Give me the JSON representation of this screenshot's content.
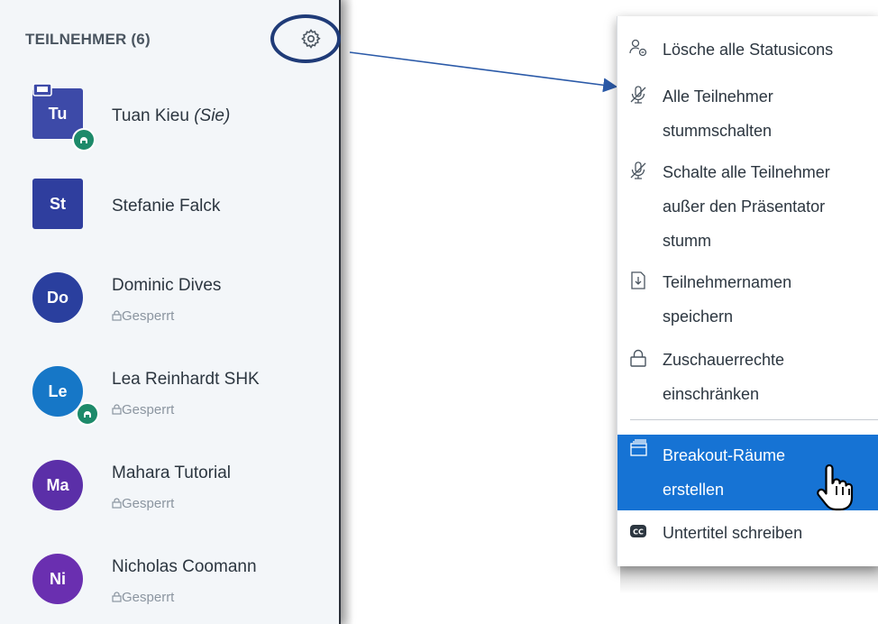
{
  "panel": {
    "title": "TEILNEHMER (6)",
    "settings_icon": "gear-icon",
    "users": [
      {
        "initials": "Tu",
        "name": "Tuan Kieu",
        "suffix": "(Sie)",
        "status": "",
        "color": "#3d4aa8",
        "shape": "square"
      },
      {
        "initials": "St",
        "name": "Stefanie Falck",
        "suffix": "",
        "status": "",
        "color": "#2f3e9e",
        "shape": "square"
      },
      {
        "initials": "Do",
        "name": "Dominic Dives",
        "suffix": "",
        "status": "Gesperrt",
        "color": "#2a3f9e",
        "shape": "circle"
      },
      {
        "initials": "Le",
        "name": "Lea Reinhardt SHK",
        "suffix": "",
        "status": "Gesperrt",
        "color": "#1677c7",
        "shape": "circle"
      },
      {
        "initials": "Ma",
        "name": "Mahara Tutorial",
        "suffix": "",
        "status": "Gesperrt",
        "color": "#5b2fa8",
        "shape": "circle"
      },
      {
        "initials": "Ni",
        "name": "Nicholas Coomann",
        "suffix": "",
        "status": "Gesperrt",
        "color": "#6a2fb0",
        "shape": "circle"
      }
    ]
  },
  "menu": {
    "items": [
      {
        "label_lines": [
          "Lösche alle Statusicons"
        ],
        "icon": "user-clear-status-icon"
      },
      {
        "label_lines": [
          "Alle Teilnehmer",
          "stummschalten"
        ],
        "icon": "mic-muted-icon"
      },
      {
        "label_lines": [
          "Schalte alle Teilnehmer",
          "außer den Präsentator",
          "stumm"
        ],
        "icon": "mic-muted-icon"
      },
      {
        "label_lines": [
          "Teilnehmernamen",
          "speichern"
        ],
        "icon": "download-file-icon"
      },
      {
        "label_lines": [
          "Zuschauerrechte",
          "einschränken"
        ],
        "icon": "lock-icon"
      },
      {
        "label_lines": [
          "Breakout-Räume",
          "erstellen"
        ],
        "icon": "breakout-rooms-icon",
        "active": true
      },
      {
        "label_lines": [
          "Untertitel schreiben"
        ],
        "icon": "closed-captions-icon"
      }
    ]
  },
  "colors": {
    "accent": "#1673d4",
    "highlight_ring": "#1f3b78",
    "talking_badge": "#1d8a6a"
  }
}
